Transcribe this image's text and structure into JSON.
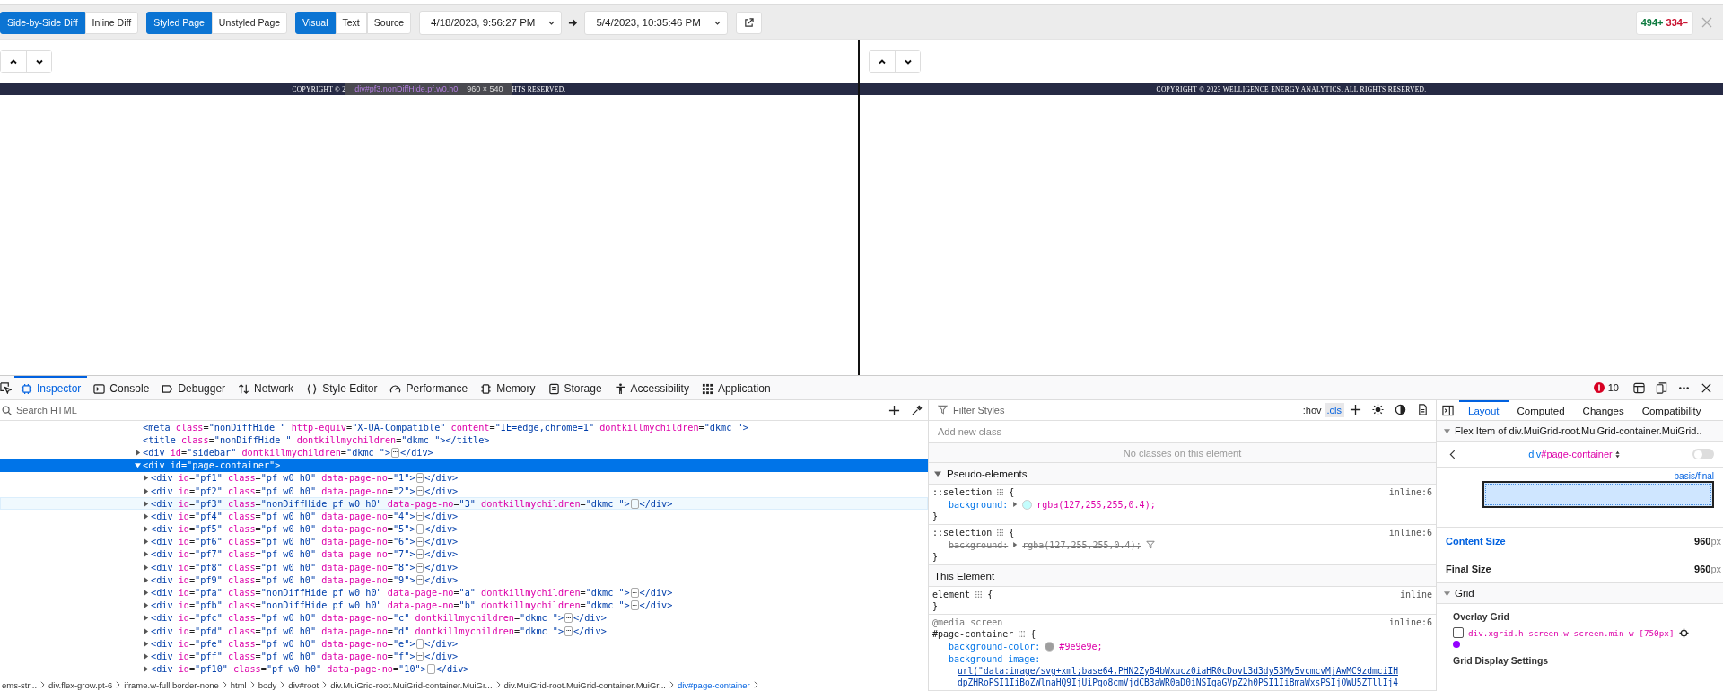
{
  "toolbar": {
    "diff_modes": [
      {
        "label": "Side-by-Side Diff",
        "selected": true
      },
      {
        "label": "Inline Diff",
        "selected": false
      }
    ],
    "style_modes": [
      {
        "label": "Styled Page",
        "selected": true
      },
      {
        "label": "Unstyled Page",
        "selected": false
      }
    ],
    "content_modes": [
      {
        "label": "Visual",
        "selected": true
      },
      {
        "label": "Text",
        "selected": false
      },
      {
        "label": "Source",
        "selected": false
      }
    ],
    "from_date": "4/18/2023, 9:56:27 PM",
    "to_date": "5/4/2023, 10:35:46 PM",
    "additions": "494+",
    "deletions": "334–"
  },
  "left_pane": {
    "footer_start": "COPYRIGHT © 2",
    "footer_end": "HTS RESERVED.",
    "tooltip": {
      "selector": "div#pf3.nonDiffHide.pf.w0.h0",
      "size": "960 × 540"
    }
  },
  "right_pane": {
    "footer": "COPYRIGHT © 2023 WELLIGENCE ENERGY ANALYTICS. ALL RIGHTS RESERVED."
  },
  "devtools": {
    "tabs": [
      {
        "label": "Inspector",
        "kind": "inspector",
        "selected": true
      },
      {
        "label": "Console",
        "kind": "console",
        "selected": false
      },
      {
        "label": "Debugger",
        "kind": "debugger",
        "selected": false
      },
      {
        "label": "Network",
        "kind": "network",
        "selected": false
      },
      {
        "label": "Style Editor",
        "kind": "style-editor",
        "selected": false
      },
      {
        "label": "Performance",
        "kind": "performance",
        "selected": false
      },
      {
        "label": "Memory",
        "kind": "memory",
        "selected": false
      },
      {
        "label": "Storage",
        "kind": "storage",
        "selected": false
      },
      {
        "label": "Accessibility",
        "kind": "accessibility",
        "selected": false
      },
      {
        "label": "Application",
        "kind": "application",
        "selected": false
      }
    ],
    "error_count": "10",
    "html_search": {
      "placeholder": "Search HTML"
    },
    "html_tree": [
      {
        "kind": "leaf",
        "markup": "<meta class=\"nonDiffHide \" http-equiv=\"X-UA-Compatible\" content=\"IE=edge,chrome=1\" dontkillmychildren=\"dkmc \">",
        "selected": false,
        "hovered": false
      },
      {
        "kind": "leaf",
        "markup": "<title class=\"nonDiffHide \" dontkillmychildren=\"dkmc \"></title>",
        "selected": false,
        "hovered": false
      },
      {
        "kind": "element",
        "markup": "<div id=\"sidebar\" dontkillmychildren=\"dkmc \">",
        "badge": "⋯",
        "closing": "</div>",
        "expanded": false,
        "selected": false,
        "hovered": false
      },
      {
        "kind": "element",
        "markup": "<div id=\"page-container\">",
        "expanded": true,
        "selected": true,
        "hovered": false,
        "children": [
          {
            "kind": "element",
            "markup": "<div id=\"pf1\" class=\"pf w0 h0\" data-page-no=\"1\">",
            "badge": "⋯",
            "closing": "</div>",
            "expanded": false,
            "selected": false,
            "hovered": false
          },
          {
            "kind": "element",
            "markup": "<div id=\"pf2\" class=\"pf w0 h0\" data-page-no=\"2\">",
            "badge": "⋯",
            "closing": "</div>",
            "expanded": false,
            "selected": false,
            "hovered": false
          },
          {
            "kind": "element",
            "markup": "<div id=\"pf3\" class=\"nonDiffHide pf w0 h0\" data-page-no=\"3\" dontkillmychildren=\"dkmc \">",
            "badge": "⋯",
            "closing": "</div>",
            "expanded": false,
            "selected": false,
            "hovered": true
          },
          {
            "kind": "element",
            "markup": "<div id=\"pf4\" class=\"pf w0 h0\" data-page-no=\"4\">",
            "badge": "⋯",
            "closing": "</div>",
            "expanded": false,
            "selected": false,
            "hovered": false
          },
          {
            "kind": "element",
            "markup": "<div id=\"pf5\" class=\"pf w0 h0\" data-page-no=\"5\">",
            "badge": "⋯",
            "closing": "</div>",
            "expanded": false,
            "selected": false,
            "hovered": false
          },
          {
            "kind": "element",
            "markup": "<div id=\"pf6\" class=\"pf w0 h0\" data-page-no=\"6\">",
            "badge": "⋯",
            "closing": "</div>",
            "expanded": false,
            "selected": false,
            "hovered": false
          },
          {
            "kind": "element",
            "markup": "<div id=\"pf7\" class=\"pf w0 h0\" data-page-no=\"7\">",
            "badge": "⋯",
            "closing": "</div>",
            "expanded": false,
            "selected": false,
            "hovered": false
          },
          {
            "kind": "element",
            "markup": "<div id=\"pf8\" class=\"pf w0 h0\" data-page-no=\"8\">",
            "badge": "⋯",
            "closing": "</div>",
            "expanded": false,
            "selected": false,
            "hovered": false
          },
          {
            "kind": "element",
            "markup": "<div id=\"pf9\" class=\"pf w0 h0\" data-page-no=\"9\">",
            "badge": "⋯",
            "closing": "</div>",
            "expanded": false,
            "selected": false,
            "hovered": false
          },
          {
            "kind": "element",
            "markup": "<div id=\"pfa\" class=\"nonDiffHide pf w0 h0\" data-page-no=\"a\" dontkillmychildren=\"dkmc \">",
            "badge": "⋯",
            "closing": "</div>",
            "expanded": false,
            "selected": false,
            "hovered": false
          },
          {
            "kind": "element",
            "markup": "<div id=\"pfb\" class=\"nonDiffHide pf w0 h0\" data-page-no=\"b\" dontkillmychildren=\"dkmc \">",
            "badge": "⋯",
            "closing": "</div>",
            "expanded": false,
            "selected": false,
            "hovered": false
          },
          {
            "kind": "element",
            "markup": "<div id=\"pfc\" class=\"pf w0 h0\" data-page-no=\"c\" dontkillmychildren=\"dkmc \">",
            "badge": "⋯",
            "closing": "</div>",
            "expanded": false,
            "selected": false,
            "hovered": false
          },
          {
            "kind": "element",
            "markup": "<div id=\"pfd\" class=\"pf w0 h0\" data-page-no=\"d\" dontkillmychildren=\"dkmc \">",
            "badge": "⋯",
            "closing": "</div>",
            "expanded": false,
            "selected": false,
            "hovered": false
          },
          {
            "kind": "element",
            "markup": "<div id=\"pfe\" class=\"pf w0 h0\" data-page-no=\"e\">",
            "badge": "⋯",
            "closing": "</div>",
            "expanded": false,
            "selected": false,
            "hovered": false
          },
          {
            "kind": "element",
            "markup": "<div id=\"pff\" class=\"pf w0 h0\" data-page-no=\"f\">",
            "badge": "⋯",
            "closing": "</div>",
            "expanded": false,
            "selected": false,
            "hovered": false
          },
          {
            "kind": "element",
            "markup": "<div id=\"pf10\" class=\"pf w0 h0\" data-page-no=\"10\">",
            "badge": "⋯",
            "closing": "</div>",
            "expanded": false,
            "selected": false,
            "hovered": false
          }
        ]
      }
    ],
    "breadcrumbs": [
      {
        "label": "ems-str...",
        "selected": false
      },
      {
        "label": "div.flex-grow.pt-6",
        "selected": false
      },
      {
        "label": "iframe.w-full.border-none",
        "selected": false
      },
      {
        "label": "html",
        "selected": false
      },
      {
        "label": "body",
        "selected": false
      },
      {
        "label": "div#root",
        "selected": false
      },
      {
        "label": "div.MuiGrid-root.MuiGrid-container.MuiGr...",
        "selected": false
      },
      {
        "label": "div.MuiGrid-root.MuiGrid-container.MuiGr...",
        "selected": false
      },
      {
        "label": "div#page-container",
        "selected": true
      }
    ],
    "styles": {
      "filter_placeholder": "Filter Styles",
      "toggles": [
        {
          "label": ":hov",
          "selected": false
        },
        {
          "label": ".cls",
          "selected": true
        }
      ],
      "class_placeholder": "Add new class",
      "no_classes": "No classes on this element",
      "sections": [
        {
          "title": "Pseudo-elements",
          "kind": "collapsible",
          "expanded": true,
          "rules": [
            {
              "selector": "::selection",
              "open": "{",
              "close": "}",
              "source": "inline:6",
              "declarations": [
                {
                  "property": "background:",
                  "value": "rgba(127,255,255,0.4);",
                  "color": "#c4fdfd",
                  "expanded": false,
                  "overridden": false
                }
              ]
            },
            {
              "selector": "::selection",
              "open": "{",
              "close": "}",
              "source": "inline:6",
              "declarations": [
                {
                  "property": "background:",
                  "value": "rgba(127,255,255,0.4);",
                  "expanded": false,
                  "overridden": true
                }
              ]
            }
          ]
        },
        {
          "title": "This Element",
          "kind": "plain",
          "rules": [
            {
              "selector": "element",
              "open": "{",
              "close": "}",
              "source": "inline"
            },
            {
              "at_rule": "@media screen",
              "selector": "#page-container",
              "open": "{",
              "source": "inline:6",
              "declarations": [
                {
                  "property": "background-color:",
                  "value": "#9e9e9e;",
                  "color": "#9e9e9e",
                  "overridden": false
                },
                {
                  "property": "background-image:",
                  "value_lines": [
                    "url(\"data:image/svg+xml;base64,PHN2ZyB4bWxucz0iaHR0cDovL3d3dy53My5vcmcvMjAwMC9zdmciIH",
                    "dpZHRoPSI1IiBoZWlnaHQ9IjUiPgo8cmVjdCB3aWR0aD0iNSIgaGVpZ2h0PSI1IiBmaWxsPSIjOWU5ZTllIj4"
                  ],
                  "overridden": false
                }
              ]
            }
          ]
        }
      ]
    },
    "layout": {
      "tabs": [
        {
          "label": "Layout",
          "selected": true
        },
        {
          "label": "Computed",
          "selected": false
        },
        {
          "label": "Changes",
          "selected": false
        },
        {
          "label": "Compatibility",
          "selected": false
        }
      ],
      "flex_item_header": "Flex Item of div.MuiGrid-root.MuiGrid-container.MuiGrid..",
      "flex_expanded": true,
      "element_tag": "div",
      "element_id": "#page-container",
      "highlight_on": false,
      "basis_label": "basis/final",
      "sizes": [
        {
          "label": "Content Size",
          "value": "960",
          "unit": "px",
          "kind": "link"
        },
        {
          "label": "Final Size",
          "value": "960",
          "unit": "px",
          "kind": "plain"
        }
      ],
      "grid_header": "Grid",
      "grid_expanded": true,
      "overlay_title": "Overlay Grid",
      "grids": [
        {
          "selector": "div.xgrid.h-screen.w-screen.min-w-[750px]",
          "checked": false,
          "color": "#9400ff"
        }
      ],
      "display_settings_title": "Grid Display Settings"
    }
  }
}
